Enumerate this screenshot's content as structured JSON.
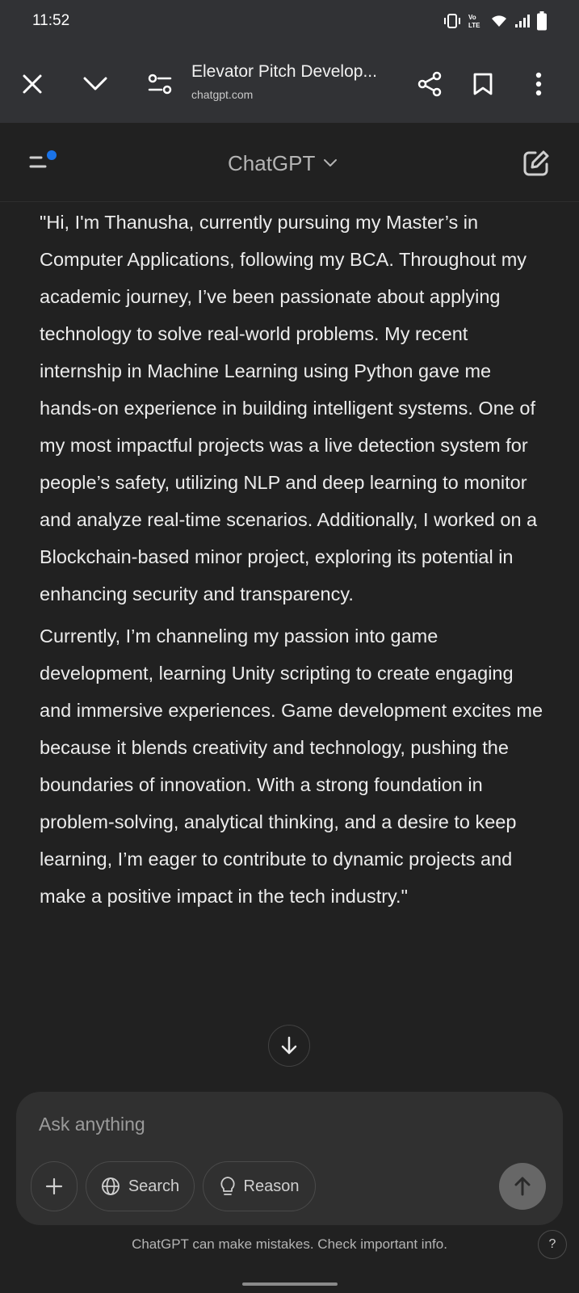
{
  "status_bar": {
    "time": "11:52",
    "icons": [
      "vibrate-icon",
      "volte-icon",
      "wifi-icon",
      "signal-icon",
      "battery-icon"
    ]
  },
  "browser": {
    "title": "Elevator Pitch Develop...",
    "domain": "chatgpt.com",
    "icons": [
      "close-icon",
      "chevron-down-icon",
      "site-settings-icon",
      "share-icon",
      "bookmark-icon",
      "more-vert-icon"
    ]
  },
  "app_header": {
    "model_name": "ChatGPT",
    "accent_color": "#1a73e8"
  },
  "message": {
    "paragraphs": [
      "\"Hi, I'm Thanusha, currently pursuing my Master’s in Computer Applications, following my BCA. Throughout my academic journey, I’ve been passionate about applying technology to solve real-world problems. My recent internship in Machine Learning using Python gave me hands-on experience in building intelligent systems. One of my most impactful projects was a live detection system for people’s safety, utilizing NLP and deep learning to monitor and analyze real-time scenarios. Additionally, I worked on a Blockchain-based minor project, exploring its potential in enhancing security and transparency.",
      "Currently, I’m channeling my passion into game development, learning Unity scripting to create engaging and immersive experiences. Game development excites me because it blends creativity and technology, pushing the boundaries of innovation. With a strong foundation in problem-solving, analytical thinking, and a desire to keep learning, I’m eager to contribute to dynamic projects and make a positive impact in the tech industry.\""
    ]
  },
  "composer": {
    "placeholder": "Ask anything",
    "search_label": "Search",
    "reason_label": "Reason"
  },
  "footer": {
    "disclaimer": "ChatGPT can make mistakes. Check important info.",
    "help_label": "?"
  }
}
